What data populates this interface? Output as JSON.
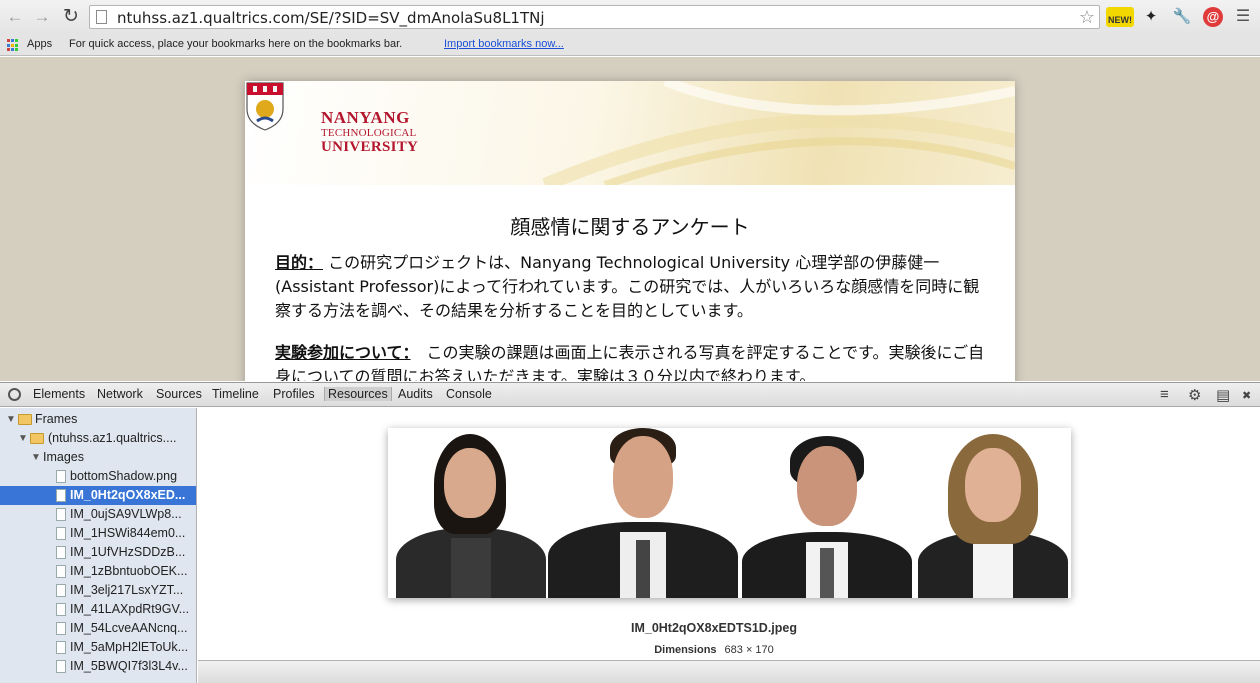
{
  "browser": {
    "url": "ntuhss.az1.qualtrics.com/SE/?SID=SV_dmAnolaSu8L1TNj",
    "extension_badge": "NEW!"
  },
  "bookmarks_bar": {
    "apps_label": "Apps",
    "hint_text": "For quick access, place your bookmarks here on the bookmarks bar.",
    "import_link": "Import bookmarks now..."
  },
  "page": {
    "logo": {
      "line1": "NANYANG",
      "line2": "TECHNOLOGICAL",
      "line3": "UNIVERSITY"
    },
    "title": "顔感情に関するアンケート",
    "purpose_label": "目的：",
    "purpose_text": " この研究プロジェクトは、Nanyang Technological University 心理学部の伊藤健一(Assistant Professor)によって行われています。この研究では、人がいろいろな顔感情を同時に観察する方法を調べ、その結果を分析することを目的としています。",
    "participation_label": "実験参加について：",
    "participation_text": "　この実験の課題は画面上に表示される写真を評定することです。実験後にご自身についての質問にお答えいただきます。実験は３０分以内で終わります。"
  },
  "devtools": {
    "tabs": [
      "Elements",
      "Network",
      "Sources",
      "Timeline",
      "Profiles",
      "Resources",
      "Audits",
      "Console"
    ],
    "active_tab": "Resources",
    "tree": {
      "frames_label": "Frames",
      "frame_label": "(ntuhss.az1.qualtrics....",
      "images_label": "Images",
      "files": [
        "bottomShadow.png",
        "IM_0Ht2qOX8xED...",
        "IM_0ujSA9VLWp8...",
        "IM_1HSWi844em0...",
        "IM_1UfVHzSDDzB...",
        "IM_1zBbntuobOEK...",
        "IM_3elj217LsxYZT...",
        "IM_41LAXpdRt9GV...",
        "IM_54LcveAANcnq...",
        "IM_5aMpH2lEToUk...",
        "IM_5BWQI7f3l3L4v..."
      ],
      "selected_index": 1
    },
    "preview": {
      "filename": "IM_0Ht2qOX8xEDTS1D.jpeg",
      "dimensions_label": "Dimensions",
      "dimensions_value": "683 × 170"
    }
  }
}
